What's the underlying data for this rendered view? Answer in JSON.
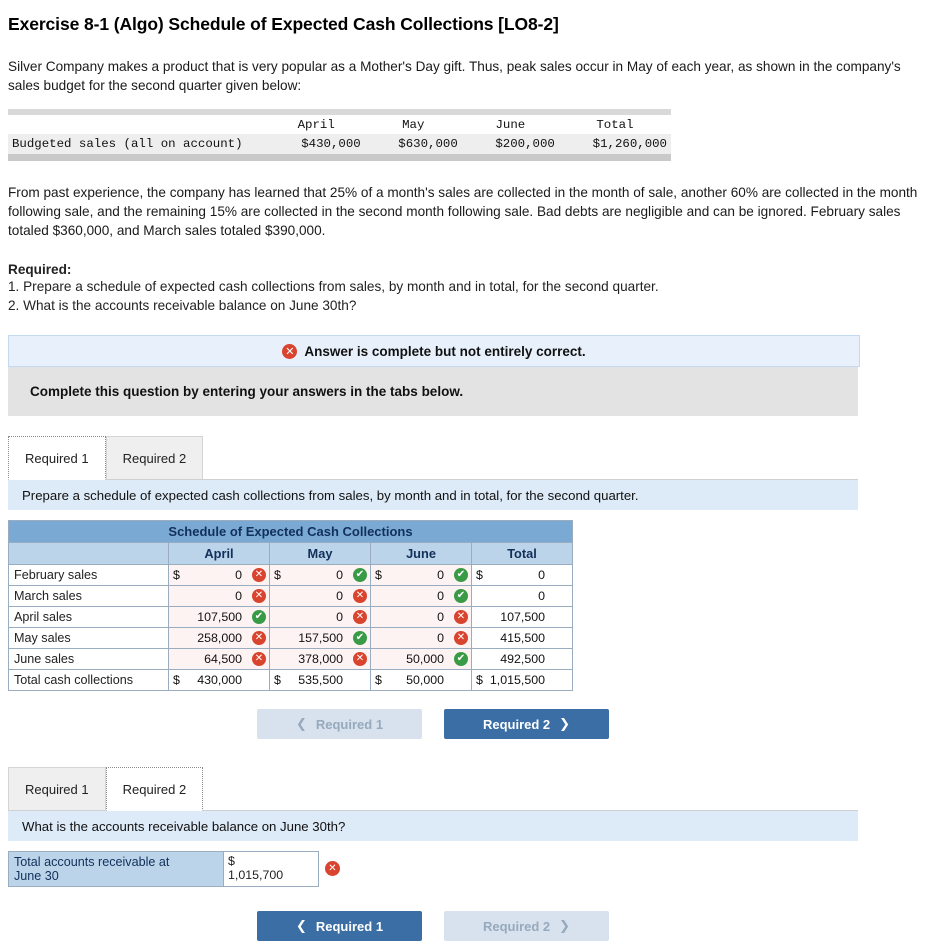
{
  "title": "Exercise 8-1 (Algo) Schedule of Expected Cash Collections [LO8-2]",
  "intro": "Silver Company makes a product that is very popular as a Mother's Day gift. Thus, peak sales occur in May of each year, as shown in the company's sales budget for the second quarter given below:",
  "budget": {
    "columns": [
      "April",
      "May",
      "June",
      "Total"
    ],
    "row_label": "Budgeted sales (all on account)",
    "values": [
      "$430,000",
      "$630,000",
      "$200,000",
      "$1,260,000"
    ]
  },
  "paragraph2": "From past experience, the company has learned that 25% of a month's sales are collected in the month of sale, another 60% are collected in the month following sale, and the remaining 15% are collected in the second month following sale. Bad debts are negligible and can be ignored. February sales totaled $360,000, and March sales totaled $390,000.",
  "required": {
    "heading": "Required:",
    "item1": "1. Prepare a schedule of expected cash collections from sales, by month and in total, for the second quarter.",
    "item2": "2. What is the accounts receivable balance on June 30th?"
  },
  "alert": {
    "icon": "x-circle-icon",
    "text": "Answer is complete but not entirely correct."
  },
  "instruction": "Complete this question by entering your answers in the tabs below.",
  "tabs1": {
    "active": "Required 1",
    "inactive": "Required 2"
  },
  "prompt1": "Prepare a schedule of expected cash collections from sales, by month and in total, for the second quarter.",
  "schedule": {
    "title": "Schedule of Expected Cash Collections",
    "columns": [
      "April",
      "May",
      "June",
      "Total"
    ],
    "rows": [
      {
        "label": "February sales",
        "cells": [
          {
            "dollar": "$",
            "value": "0",
            "mark": "bad"
          },
          {
            "dollar": "$",
            "value": "0",
            "mark": "good"
          },
          {
            "dollar": "$",
            "value": "0",
            "mark": "good"
          },
          {
            "dollar": "$",
            "value": "0",
            "mark": ""
          }
        ]
      },
      {
        "label": "March sales",
        "cells": [
          {
            "dollar": "",
            "value": "0",
            "mark": "bad"
          },
          {
            "dollar": "",
            "value": "0",
            "mark": "bad"
          },
          {
            "dollar": "",
            "value": "0",
            "mark": "good"
          },
          {
            "dollar": "",
            "value": "0",
            "mark": ""
          }
        ]
      },
      {
        "label": "April sales",
        "cells": [
          {
            "dollar": "",
            "value": "107,500",
            "mark": "good"
          },
          {
            "dollar": "",
            "value": "0",
            "mark": "bad"
          },
          {
            "dollar": "",
            "value": "0",
            "mark": "bad"
          },
          {
            "dollar": "",
            "value": "107,500",
            "mark": ""
          }
        ]
      },
      {
        "label": "May sales",
        "cells": [
          {
            "dollar": "",
            "value": "258,000",
            "mark": "bad"
          },
          {
            "dollar": "",
            "value": "157,500",
            "mark": "good"
          },
          {
            "dollar": "",
            "value": "0",
            "mark": "bad"
          },
          {
            "dollar": "",
            "value": "415,500",
            "mark": ""
          }
        ]
      },
      {
        "label": "June sales",
        "cells": [
          {
            "dollar": "",
            "value": "64,500",
            "mark": "bad"
          },
          {
            "dollar": "",
            "value": "378,000",
            "mark": "bad"
          },
          {
            "dollar": "",
            "value": "50,000",
            "mark": "good"
          },
          {
            "dollar": "",
            "value": "492,500",
            "mark": ""
          }
        ]
      }
    ],
    "total_row": {
      "label": "Total cash collections",
      "cells": [
        {
          "dollar": "$",
          "value": "430,000"
        },
        {
          "dollar": "$",
          "value": "535,500"
        },
        {
          "dollar": "$",
          "value": "50,000"
        },
        {
          "dollar": "$",
          "value": "1,015,500"
        }
      ]
    }
  },
  "nav1": {
    "prev": "Required 1",
    "next": "Required 2",
    "prev_icon": "chevron-left-icon",
    "next_icon": "chevron-right-icon"
  },
  "tabs2": {
    "inactive": "Required 1",
    "active": "Required 2"
  },
  "prompt2": "What is the accounts receivable balance on June 30th?",
  "q2": {
    "label_line1": "Total accounts receivable at",
    "label_line2": "June 30",
    "dollar": "$",
    "value": "1,015,700",
    "mark": "x-circle-icon"
  },
  "nav2": {
    "prev": "Required 1",
    "next": "Required 2",
    "prev_icon": "chevron-left-icon",
    "next_icon": "chevron-right-icon"
  },
  "glyphs": {
    "x": "✕",
    "check": "✔",
    "left": "❮",
    "right": "❯"
  }
}
